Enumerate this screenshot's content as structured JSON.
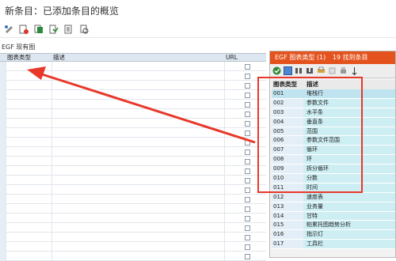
{
  "window": {
    "title": "新条目：已添加条目的概览"
  },
  "toolbar": {
    "buttons": [
      {
        "name": "display-change-icon"
      },
      {
        "name": "delete-icon"
      },
      {
        "name": "copy-icon"
      },
      {
        "name": "select-all-icon"
      },
      {
        "name": "deselect-icon"
      },
      {
        "name": "print-icon"
      }
    ]
  },
  "section": {
    "title": "EGF 现有图"
  },
  "main_table": {
    "columns": [
      "图表类型",
      "描述",
      "URL"
    ],
    "row_count": 21
  },
  "popup": {
    "title": "EGF 图表类型 (1)",
    "hits": "19 找到条目",
    "columns": [
      "图表类型",
      "描述"
    ],
    "rows": [
      {
        "code": "001",
        "desc": "堆栈行"
      },
      {
        "code": "002",
        "desc": "参数文件"
      },
      {
        "code": "003",
        "desc": "水平条"
      },
      {
        "code": "004",
        "desc": "垂直条"
      },
      {
        "code": "005",
        "desc": "范围"
      },
      {
        "code": "006",
        "desc": "参数文件范围"
      },
      {
        "code": "007",
        "desc": "循环"
      },
      {
        "code": "008",
        "desc": "环"
      },
      {
        "code": "009",
        "desc": "拆分循环"
      },
      {
        "code": "010",
        "desc": "分数"
      },
      {
        "code": "011",
        "desc": "时间"
      },
      {
        "code": "012",
        "desc": "速度表"
      },
      {
        "code": "013",
        "desc": "业务量"
      },
      {
        "code": "014",
        "desc": "甘特"
      },
      {
        "code": "015",
        "desc": "帕累托图趋势分析"
      },
      {
        "code": "016",
        "desc": "指示灯"
      },
      {
        "code": "017",
        "desc": "工具栏"
      }
    ]
  },
  "colors": {
    "popup_title_bg": "#e4531d",
    "annotation_red": "#e8382a",
    "row_highlight": "#cdeef3"
  }
}
